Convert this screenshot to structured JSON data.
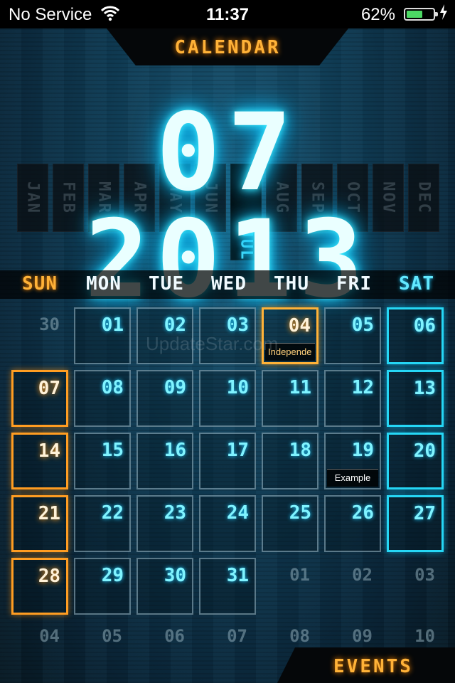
{
  "status_bar": {
    "carrier": "No Service",
    "time": "11:37",
    "battery_percent": "62%",
    "battery_level": 0.62,
    "wifi_icon": "wifi-icon",
    "charging_icon": "lightning-bolt-icon"
  },
  "header": {
    "title": "CALENDAR"
  },
  "big_date": "07 2013",
  "months": [
    "JAN",
    "FEB",
    "MAR",
    "APR",
    "MAY",
    "JUN",
    "JUL",
    "AUG",
    "SEP",
    "OCT",
    "NOV",
    "DEC"
  ],
  "selected_month": "JUL",
  "weekdays": [
    "SUN",
    "MON",
    "TUE",
    "WED",
    "THU",
    "FRI",
    "SAT"
  ],
  "weeks": [
    [
      {
        "day": "30",
        "type": "other"
      },
      {
        "day": "01",
        "type": "current"
      },
      {
        "day": "02",
        "type": "current"
      },
      {
        "day": "03",
        "type": "current"
      },
      {
        "day": "04",
        "type": "today",
        "event": "Independe"
      },
      {
        "day": "05",
        "type": "current"
      },
      {
        "day": "06",
        "type": "sat"
      }
    ],
    [
      {
        "day": "07",
        "type": "sun"
      },
      {
        "day": "08",
        "type": "current"
      },
      {
        "day": "09",
        "type": "current"
      },
      {
        "day": "10",
        "type": "current"
      },
      {
        "day": "11",
        "type": "current"
      },
      {
        "day": "12",
        "type": "current"
      },
      {
        "day": "13",
        "type": "sat"
      }
    ],
    [
      {
        "day": "14",
        "type": "sun"
      },
      {
        "day": "15",
        "type": "current"
      },
      {
        "day": "16",
        "type": "current"
      },
      {
        "day": "17",
        "type": "current"
      },
      {
        "day": "18",
        "type": "current"
      },
      {
        "day": "19",
        "type": "current",
        "event": "Example"
      },
      {
        "day": "20",
        "type": "sat"
      }
    ],
    [
      {
        "day": "21",
        "type": "sun"
      },
      {
        "day": "22",
        "type": "current"
      },
      {
        "day": "23",
        "type": "current"
      },
      {
        "day": "24",
        "type": "current"
      },
      {
        "day": "25",
        "type": "current"
      },
      {
        "day": "26",
        "type": "current"
      },
      {
        "day": "27",
        "type": "sat"
      }
    ],
    [
      {
        "day": "28",
        "type": "sun"
      },
      {
        "day": "29",
        "type": "current"
      },
      {
        "day": "30",
        "type": "current"
      },
      {
        "day": "31",
        "type": "current"
      },
      {
        "day": "01",
        "type": "other"
      },
      {
        "day": "02",
        "type": "other"
      },
      {
        "day": "03",
        "type": "other"
      }
    ],
    [
      {
        "day": "04",
        "type": "other"
      },
      {
        "day": "05",
        "type": "other"
      },
      {
        "day": "06",
        "type": "other"
      },
      {
        "day": "07",
        "type": "other"
      },
      {
        "day": "08",
        "type": "other"
      },
      {
        "day": "09",
        "type": "other"
      },
      {
        "day": "10",
        "type": "other"
      }
    ]
  ],
  "watermark": "UpdateStar.com",
  "events_tab": {
    "label": "EVENTS"
  },
  "colors": {
    "accent_orange": "#ffb238",
    "accent_cyan": "#26d7f5",
    "background": "#0b2230"
  }
}
